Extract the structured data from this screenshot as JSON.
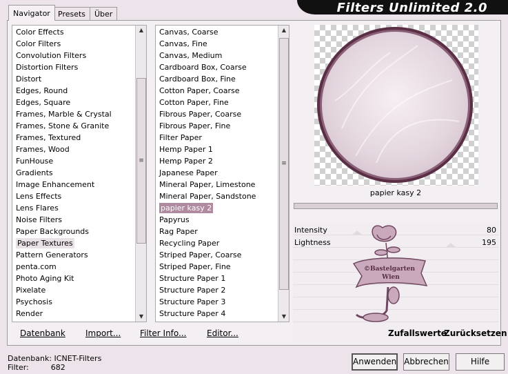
{
  "app": {
    "title": "Filters Unlimited 2.0"
  },
  "tabs": [
    {
      "label": "Navigator",
      "active": true
    },
    {
      "label": "Presets",
      "active": false
    },
    {
      "label": "Über",
      "active": false
    }
  ],
  "categories": [
    "Color Effects",
    "Color Filters",
    "Convolution Filters",
    "Distortion Filters",
    "Distort",
    "Edges, Round",
    "Edges, Square",
    "Frames, Marble & Crystal",
    "Frames, Stone & Granite",
    "Frames, Textured",
    "Frames, Wood",
    "FunHouse",
    "Gradients",
    "Image Enhancement",
    "Lens Effects",
    "Lens Flares",
    "Noise Filters",
    "Paper Backgrounds",
    "Paper Textures",
    "Pattern Generators",
    "penta.com",
    "Photo Aging Kit",
    "Pixelate",
    "Psychosis",
    "Render"
  ],
  "categories_selected_index": 18,
  "filters": [
    "Canvas, Coarse",
    "Canvas, Fine",
    "Canvas, Medium",
    "Cardboard Box, Coarse",
    "Cardboard Box, Fine",
    "Cotton Paper, Coarse",
    "Cotton Paper, Fine",
    "Fibrous Paper, Coarse",
    "Fibrous Paper, Fine",
    "Filter Paper",
    "Hemp Paper 1",
    "Hemp Paper 2",
    "Japanese Paper",
    "Mineral Paper, Limestone",
    "Mineral Paper, Sandstone",
    "papier kasy 2",
    "Papyrus",
    "Rag Paper",
    "Recycling Paper",
    "Striped Paper, Coarse",
    "Striped Paper, Fine",
    "Structure Paper 1",
    "Structure Paper 2",
    "Structure Paper 3",
    "Structure Paper 4"
  ],
  "filters_selected_index": 15,
  "bottom_links": {
    "datenbank": "Datenbank",
    "import": "Import...",
    "filter_info": "Filter Info...",
    "editor": "Editor..."
  },
  "preview": {
    "filter_name": "papier kasy 2"
  },
  "parameters": [
    {
      "name": "Intensity",
      "value": "80"
    },
    {
      "name": "Lightness",
      "value": "195"
    }
  ],
  "watermark": {
    "line1": "©Bastelgarten",
    "line2": "Wien"
  },
  "action_links": {
    "randomize": "Zufallswerte",
    "reset": "Zurücksetzen"
  },
  "status": {
    "db_label": "Datenbank:",
    "db_value": "ICNET-Filters",
    "filter_label": "Filter:",
    "filter_value": "682"
  },
  "buttons": {
    "apply": "Anwenden",
    "cancel": "Abbrechen",
    "help": "Hilfe"
  },
  "colors": {
    "accent": "#b08aa0",
    "frame": "#7a4d66",
    "banner": "#111111"
  }
}
